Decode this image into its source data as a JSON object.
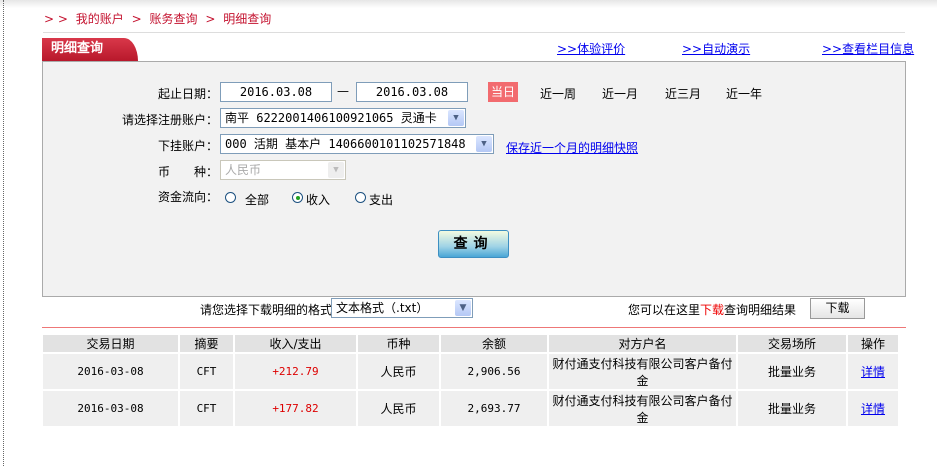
{
  "breadcrumb": [
    "> >",
    "我的账户",
    ">",
    "账务查询",
    ">",
    "明细查询"
  ],
  "tab_title": "明细查询",
  "top_links": [
    ">>体验评价",
    ">>自动演示",
    ">>查看栏目信息"
  ],
  "form": {
    "date_label": "起止日期：",
    "start_date": "2016.03.08",
    "dash": "—",
    "end_date": "2016.03.08",
    "today": "当日",
    "ranges": [
      "近一周",
      "近一月",
      "近三月",
      "近一年"
    ],
    "account_label": "请选择注册账户：",
    "account_value": "南平 6222001406100921065 灵通卡",
    "sub_label": "下挂账户：",
    "sub_value": "000 活期 基本户 1406600101102571848",
    "snapshot_link": "保存近一个月的明细快照",
    "currency_label": "币　　种：",
    "currency_value": "人民币",
    "flow_label": "资金流向：",
    "flow_options": [
      "全部",
      "收入",
      "支出"
    ],
    "flow_selected": "收入",
    "query_button": "查询"
  },
  "download": {
    "format_label": "请您选择下载明细的格式",
    "format_value": "文本格式（.txt）",
    "hint_prefix": "您可以在这里",
    "hint_em": "下载",
    "hint_suffix": "查询明细结果",
    "button": "下载"
  },
  "table": {
    "headers": [
      "交易日期",
      "摘要",
      "收入/支出",
      "币种",
      "余额",
      "对方户名",
      "交易场所",
      "操作"
    ],
    "rows": [
      [
        "2016-03-08",
        "CFT",
        "+212.79",
        "人民币",
        "2,906.56",
        "财付通支付科技有限公司客户备付金",
        "批量业务",
        "详情"
      ],
      [
        "2016-03-08",
        "CFT",
        "+177.82",
        "人民币",
        "2,693.77",
        "财付通支付科技有限公司客户备付金",
        "批量业务",
        "详情"
      ]
    ]
  },
  "colors": {
    "accent": "#c4122f",
    "income": "#dd0000",
    "link": "#0000ee"
  }
}
